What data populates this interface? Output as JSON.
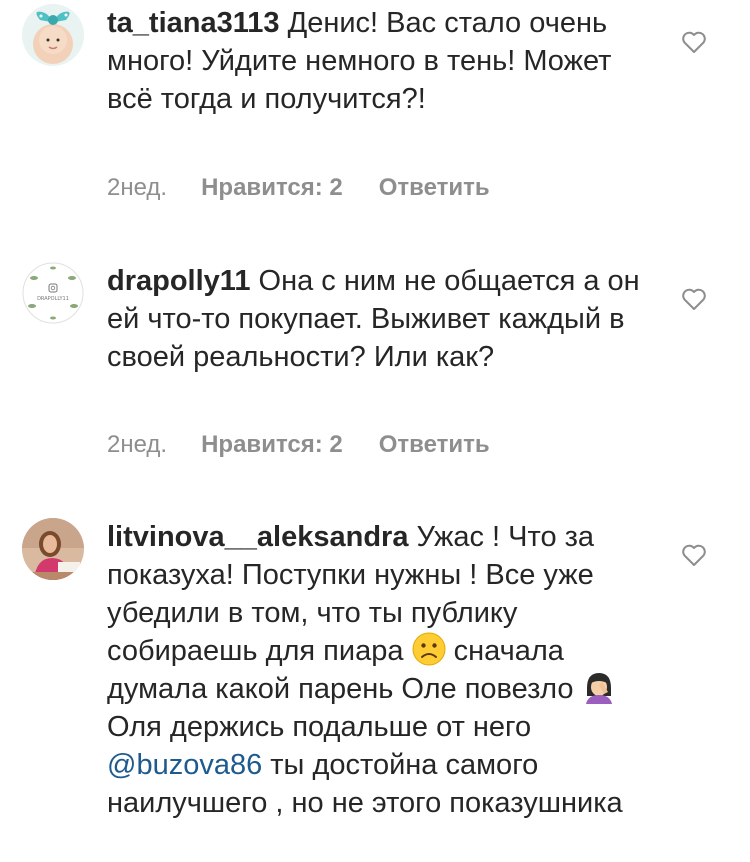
{
  "comments": [
    {
      "username": "ta_tiana3113",
      "text": " Денис! Вас стало очень много! Уйдите немного в тень! Может всё тогда и получится?!",
      "time": "2нед.",
      "likes": "Нравится: 2",
      "reply": "Ответить"
    },
    {
      "username": "drapolly11",
      "text": " Она с ним не общается а он ей что-то покупает. Выживет каждый в своей реальности? Или как?",
      "time": "2нед.",
      "likes": "Нравится: 2",
      "reply": "Ответить",
      "avatar_text": "DRAPOLLY11"
    },
    {
      "username": "litvinova__aleksandra",
      "text_part1": " Ужас ! Что за показуха! Поступки нужны ! Все уже убедили в том, что ты публику собираешь для пиара",
      "text_part2": " сначала думала какой парень Оле повезло",
      "text_part3": " Оля держись подальше от него ",
      "mention": "@buzova86",
      "text_part4": " ты достойна самого наилучшего , но не этого показушника"
    }
  ],
  "colors": {
    "text": "#262626",
    "meta": "#8e8e8e",
    "mention": "#1e5a8e",
    "heart": "#8e8e8e"
  },
  "icons": [
    "heart-outline-icon",
    "frowning-face-emoji",
    "woman-facepalming-emoji"
  ]
}
